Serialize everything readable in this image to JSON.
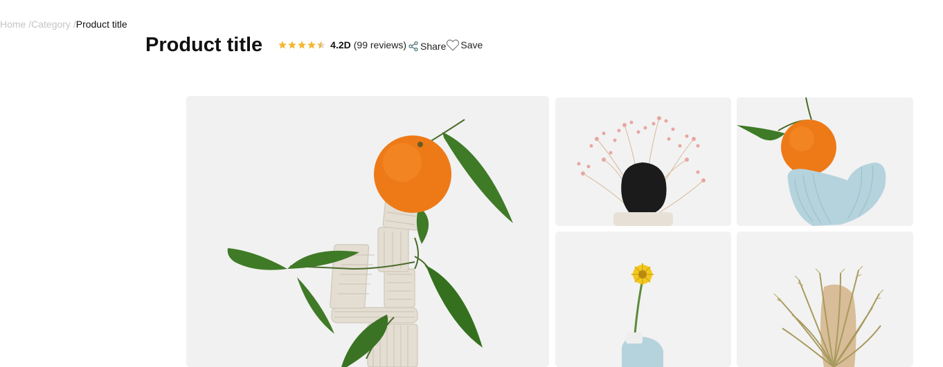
{
  "breadcrumb": {
    "home": "Home",
    "category": "Category",
    "current": "Product title",
    "separator": "/"
  },
  "product": {
    "title": "Product title",
    "rating_value": "4.2D",
    "review_count": "(99 reviews)",
    "stars_filled": 4.5,
    "stars_total": 5
  },
  "actions": {
    "share_label": "Share",
    "save_label": "Save"
  },
  "gallery": {
    "images": [
      {
        "subject": "orange-on-clay-stack"
      },
      {
        "subject": "pink-flowers-black-stone"
      },
      {
        "subject": "orange-on-blue-clay"
      },
      {
        "subject": "yellow-flower-blue-vase"
      },
      {
        "subject": "dried-banksia"
      }
    ]
  },
  "colors": {
    "star": "#f5b62e",
    "muted_text": "#c4c4c4",
    "text": "#111111",
    "share_icon": "#5a7f86"
  },
  "icons": {
    "rating": "star-icon",
    "share": "share-icon",
    "save": "heart-icon"
  }
}
